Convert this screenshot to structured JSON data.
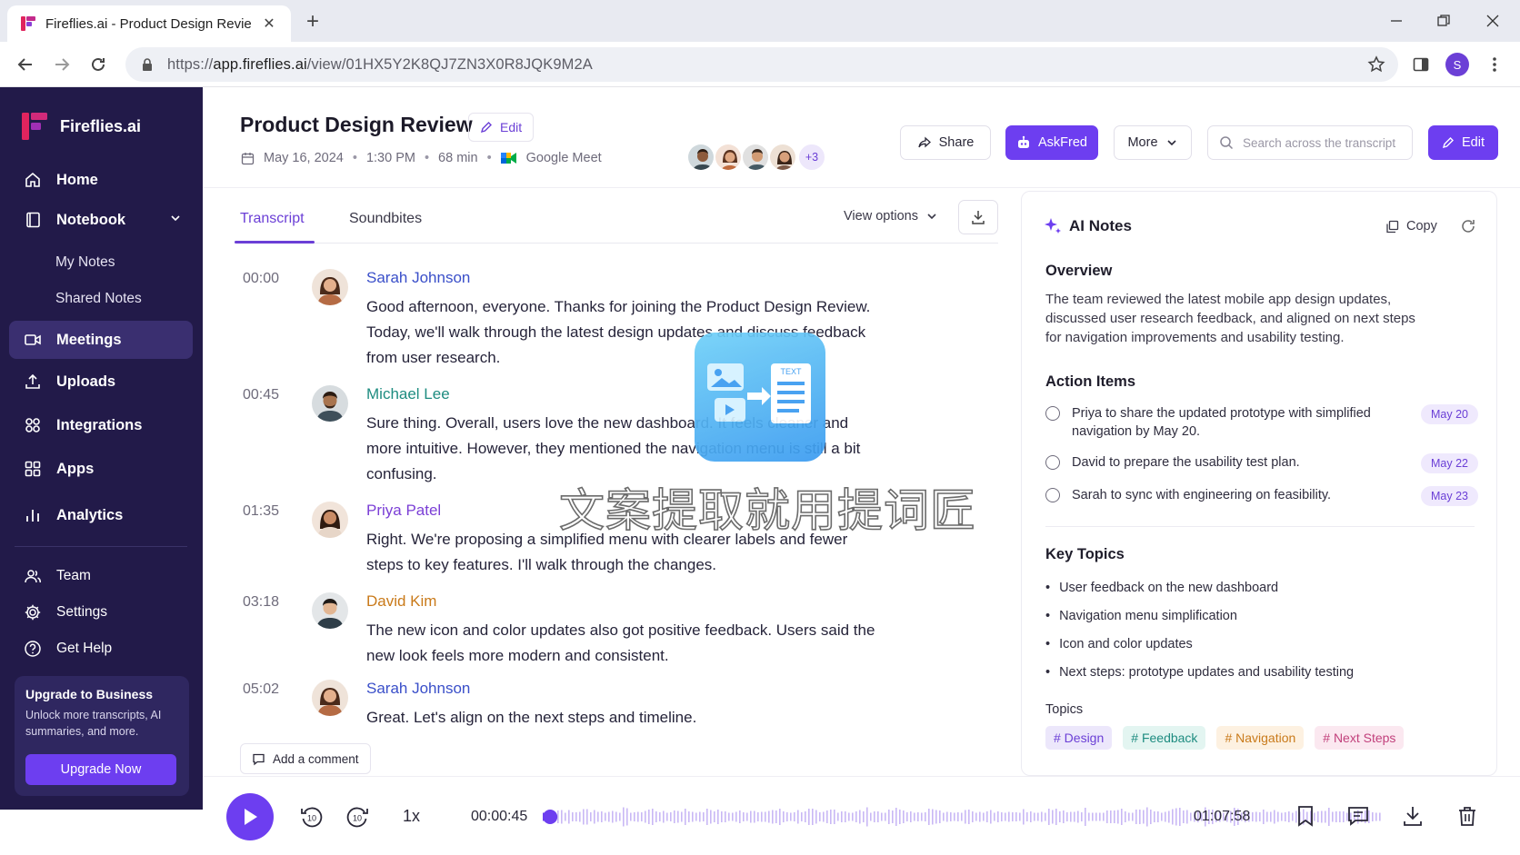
{
  "browser": {
    "tab_title": "Fireflies.ai - Product Design Review",
    "url_prefix": "https://",
    "url_host": "app.fireflies.ai",
    "url_path": "/view/01HX5Y2K8QJ7ZN3X0R8JQK9M2A",
    "profile_initial": "S"
  },
  "sidebar": {
    "brand": "Fireflies.ai",
    "home": "Home",
    "notebook": "Notebook",
    "my_notes": "My Notes",
    "shared_notes": "Shared Notes",
    "meetings": "Meetings",
    "uploads": "Uploads",
    "integrations": "Integrations",
    "apps": "Apps",
    "analytics": "Analytics",
    "team": "Team",
    "settings": "Settings",
    "get_help": "Get Help",
    "upgrade": {
      "title": "Upgrade to Business",
      "text": "Unlock more transcripts, AI summaries, and more.",
      "button": "Upgrade Now"
    }
  },
  "meeting": {
    "title": "Product Design Review",
    "edit_label": "Edit",
    "date": "May 16, 2024",
    "time": "1:30 PM",
    "duration": "68 min",
    "platform": "Google Meet",
    "extra_participants": "+3"
  },
  "header": {
    "share": "Share",
    "askfred": "AskFred",
    "more": "More",
    "search_placeholder": "Search across the transcript",
    "edit": "Edit"
  },
  "transcript": {
    "tab_transcript": "Transcript",
    "tab_soundbites": "Soundbites",
    "view_options": "View options",
    "add_comment": "Add a comment",
    "entries": [
      {
        "time": "00:00",
        "speaker": "Sarah Johnson",
        "color": "#3a4fc9",
        "text": "Good afternoon, everyone. Thanks for joining the Product Design Review. Today, we'll walk through the latest design updates and discuss feedback from user research."
      },
      {
        "time": "00:45",
        "speaker": "Michael Lee",
        "color": "#1e8c80",
        "text": "Sure thing. Overall, users love the new dashboard. It feels cleaner and more intuitive. However, they mentioned the navigation menu is still a bit confusing."
      },
      {
        "time": "01:35",
        "speaker": "Priya Patel",
        "color": "#7b3fd6",
        "text": "Right. We're proposing a simplified menu with clearer labels and fewer steps to key features. I'll walk through the changes."
      },
      {
        "time": "03:18",
        "speaker": "David Kim",
        "color": "#c97a1a",
        "text": "The new icon and color updates also got positive feedback. Users said the new look feels more modern and consistent."
      },
      {
        "time": "05:02",
        "speaker": "Sarah Johnson",
        "color": "#3a4fc9",
        "text": "Great. Let's align on the next steps and timeline."
      }
    ]
  },
  "notes": {
    "title": "AI Notes",
    "copy": "Copy",
    "overview_heading": "Overview",
    "overview": "The team reviewed the latest mobile app design updates, discussed user research feedback, and aligned on next steps for navigation improvements and usability testing.",
    "action_heading": "Action Items",
    "actions": [
      {
        "text": "Priya to share the updated prototype with simplified navigation by May 20.",
        "due": "May 20"
      },
      {
        "text": "David to prepare the usability test plan.",
        "due": "May 22"
      },
      {
        "text": "Sarah to sync with engineering on feasibility.",
        "due": "May 23"
      }
    ],
    "topics_heading": "Key Topics",
    "key_topics": [
      "User feedback on the new dashboard",
      "Navigation menu simplification",
      "Icon and color updates",
      "Next steps: prototype updates and usability testing"
    ],
    "topics_label": "Topics",
    "chips": [
      {
        "label": "# Design",
        "bg": "#ece7fb",
        "fg": "#6b3fd6"
      },
      {
        "label": "# Feedback",
        "bg": "#e3f5f1",
        "fg": "#1e8c80"
      },
      {
        "label": "# Navigation",
        "bg": "#fdf1e1",
        "fg": "#c97a1a"
      },
      {
        "label": "# Next Steps",
        "bg": "#fbe8f0",
        "fg": "#c2417c"
      }
    ]
  },
  "player": {
    "speed": "1x",
    "current": "00:00:45",
    "total": "01:07:58",
    "progress": 0.011,
    "skip_back": "10",
    "skip_forward": "10"
  },
  "overlay": {
    "watermark_text": "文案提取就用提词匠"
  }
}
